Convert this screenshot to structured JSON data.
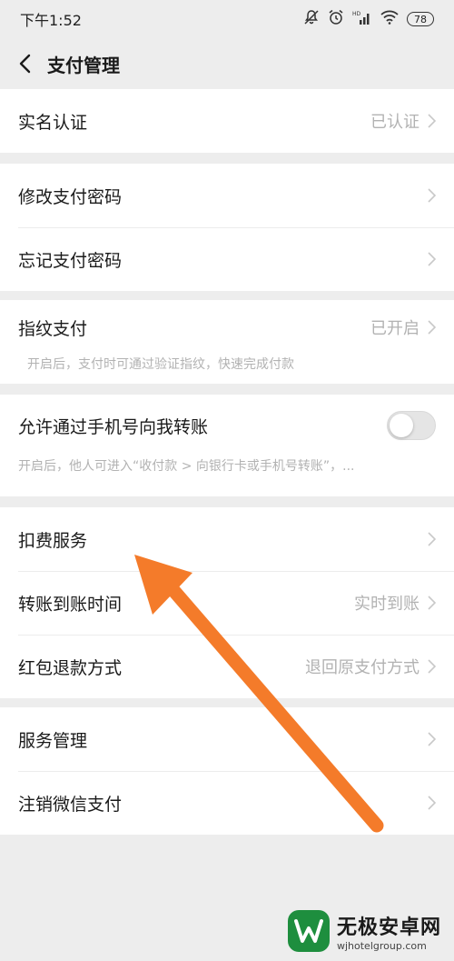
{
  "status_bar": {
    "time": "下午1:52",
    "battery": "78",
    "signal_label": "HD"
  },
  "navbar": {
    "title": "支付管理"
  },
  "groups": {
    "g1": {
      "real_name": {
        "label": "实名认证",
        "value": "已认证"
      }
    },
    "g2": {
      "change_pwd": {
        "label": "修改支付密码"
      },
      "forgot_pwd": {
        "label": "忘记支付密码"
      }
    },
    "g3": {
      "fingerprint": {
        "label": "指纹支付",
        "value": "已开启",
        "desc": "开启后，支付时可通过验证指纹，快速完成付款"
      }
    },
    "g4": {
      "phone_transfer": {
        "label": "允许通过手机号向我转账",
        "desc": "开启后，他人可进入“收付款 > 向银行卡或手机号转账”，...",
        "enabled": false
      }
    },
    "g5": {
      "deduction": {
        "label": "扣费服务"
      },
      "arrival_time": {
        "label": "转账到账时间",
        "value": "实时到账"
      },
      "red_packet_refund": {
        "label": "红包退款方式",
        "value": "退回原支付方式"
      }
    },
    "g6": {
      "service_mgmt": {
        "label": "服务管理"
      },
      "cancel_pay": {
        "label": "注销微信支付"
      }
    }
  },
  "annotation": {
    "arrow_color": "#f47b2a"
  },
  "watermark": {
    "title": "无极安卓网",
    "url": "wjhotelgroup.com"
  },
  "colors": {
    "background": "#ededed",
    "cell": "#ffffff",
    "secondary_text": "#b2b2b2",
    "brand_green": "#1e8e3e"
  }
}
